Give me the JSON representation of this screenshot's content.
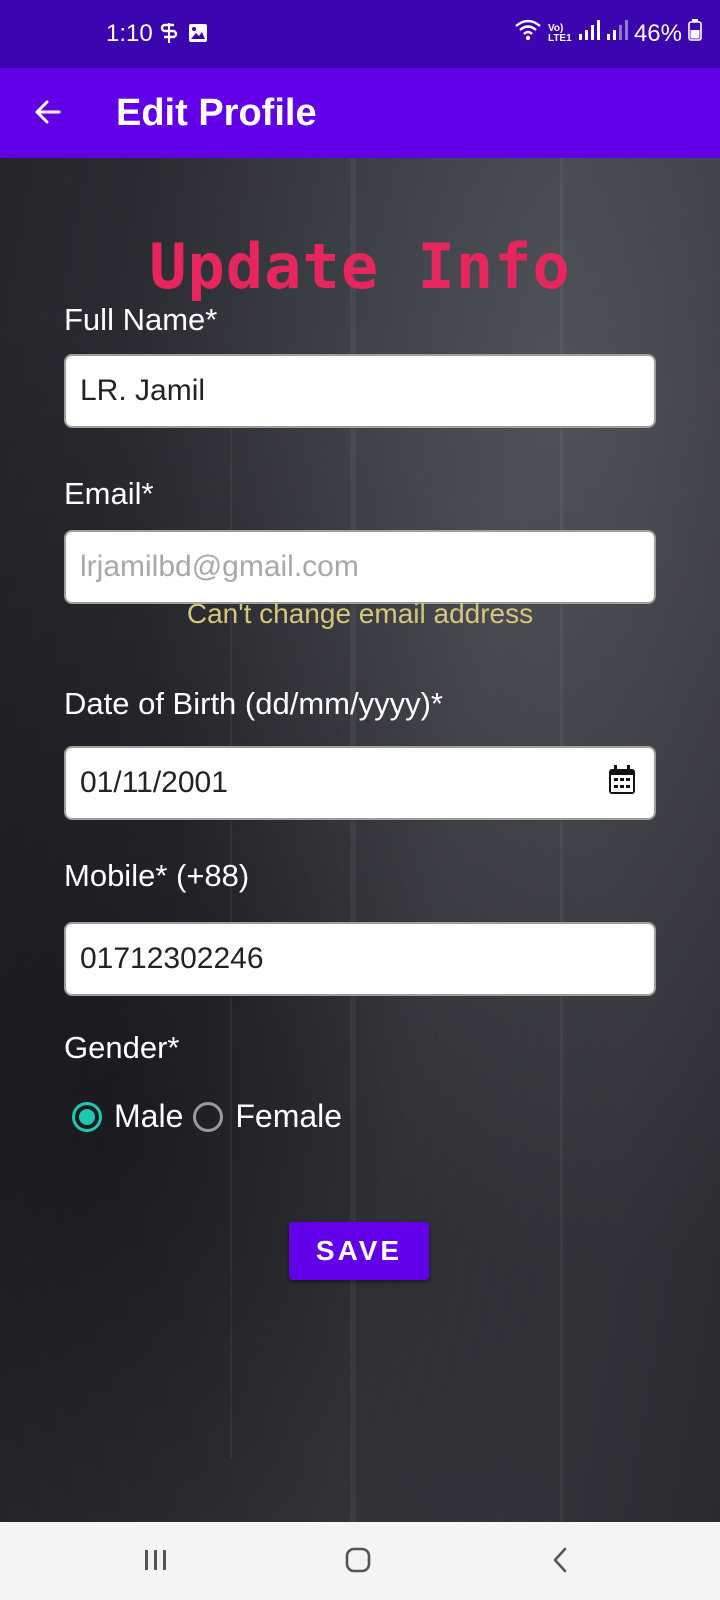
{
  "status_bar": {
    "time": "1:10",
    "battery_percent": "46%",
    "network_label": "Vo) LTE1"
  },
  "appbar": {
    "title": "Edit Profile"
  },
  "form": {
    "heading": "Update Info",
    "full_name": {
      "label": "Full Name*",
      "value": "LR. Jamil"
    },
    "email": {
      "label": "Email*",
      "value": "lrjamilbd@gmail.com",
      "helper": "Can't change email address"
    },
    "dob": {
      "label": "Date of Birth (dd/mm/yyyy)*",
      "value": "01/11/2001"
    },
    "mobile": {
      "label": "Mobile* (+88)",
      "value": "01712302246"
    },
    "gender": {
      "label": "Gender*",
      "options": [
        "Male",
        "Female"
      ],
      "selected": "Male"
    },
    "save_label": "SAVE"
  },
  "colors": {
    "status_bar": "#3b05b0",
    "appbar": "#6200ea",
    "heading": "#e8265e",
    "radio_accent": "#1ec8b0",
    "helper_text": "#d6c67a"
  }
}
